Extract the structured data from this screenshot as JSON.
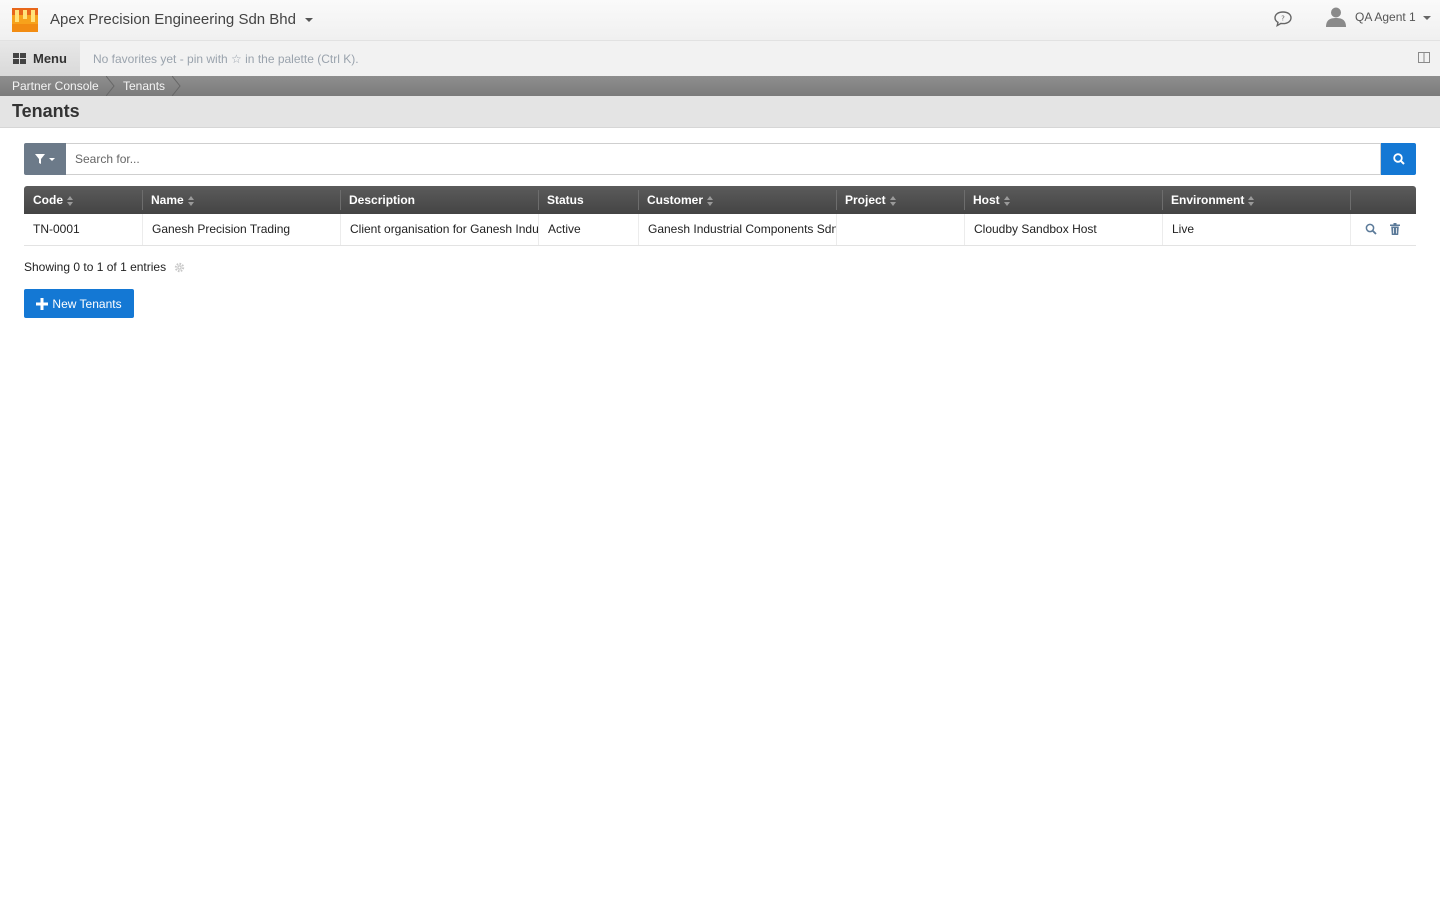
{
  "header": {
    "company_name": "Apex Precision Engineering Sdn Bhd",
    "user_name": "QA Agent 1"
  },
  "menubar": {
    "menu_label": "Menu",
    "favorites_hint": "No favorites yet - pin with ☆ in the palette (Ctrl K)."
  },
  "breadcrumb": [
    "Partner Console",
    "Tenants"
  ],
  "page": {
    "title": "Tenants"
  },
  "search": {
    "placeholder": "Search for..."
  },
  "table": {
    "columns": [
      "Code",
      "Name",
      "Description",
      "Status",
      "Customer",
      "Project",
      "Host",
      "Environment"
    ],
    "rows": [
      {
        "code": "TN-0001",
        "name": "Ganesh Precision Trading",
        "description": "Client organisation for Ganesh Industrial Components",
        "status": "Active",
        "customer": "Ganesh Industrial Components Sdn Bhd",
        "project": "",
        "host": "Cloudby Sandbox Host",
        "environment": "Live"
      }
    ]
  },
  "footer": {
    "showing_text": "Showing 0 to 1 of 1 entries",
    "new_button_label": "New Tenants"
  },
  "colors": {
    "primary": "#1478d4",
    "filter_button": "#6c7a89",
    "table_header": "#4e4e4e",
    "breadcrumb_bar": "#848484"
  },
  "icons": {
    "logo": "app-logo-icon",
    "chat": "chat-bubble-icon",
    "user": "user-avatar-icon",
    "menu": "grid-menu-icon",
    "panel": "side-panel-toggle-icon",
    "filter": "filter-icon",
    "search": "search-icon",
    "sort": "sort-icon",
    "view": "magnifier-icon",
    "delete": "trash-icon",
    "settings": "gear-icon",
    "add": "plus-icon"
  }
}
